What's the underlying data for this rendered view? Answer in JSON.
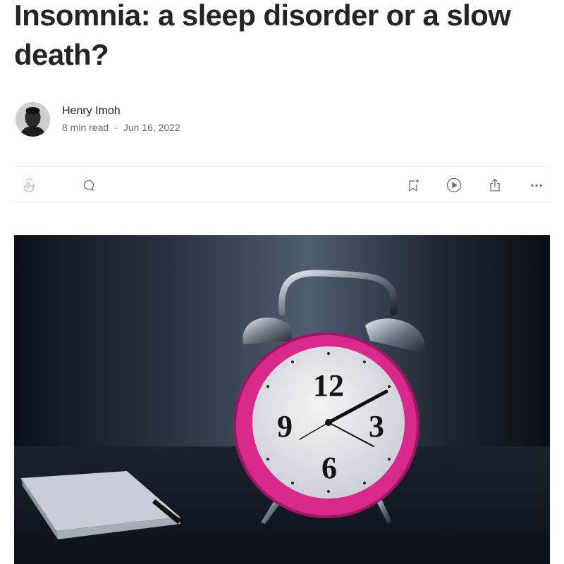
{
  "article": {
    "title": "Insomnia: a sleep disorder or a slow death?",
    "author_name": "Henry Imoh",
    "read_time": "8 min read",
    "date": "Jun 16, 2022",
    "separator": "·"
  },
  "actions": {
    "clap_icon": "clap-icon",
    "comment_icon": "comment-bubble-icon",
    "save_icon": "bookmark-add-icon",
    "listen_icon": "play-circle-icon",
    "share_icon": "share-icon",
    "more_icon": "more-dots-icon"
  },
  "hero_image": {
    "subject": "pink alarm clock",
    "clock_numerals": [
      "12",
      "3",
      "6",
      "9"
    ]
  },
  "colors": {
    "text_primary": "#242424",
    "text_secondary": "#6b6b6b",
    "divider": "#f2f2f2",
    "clock_pink": "#d92a8c"
  }
}
